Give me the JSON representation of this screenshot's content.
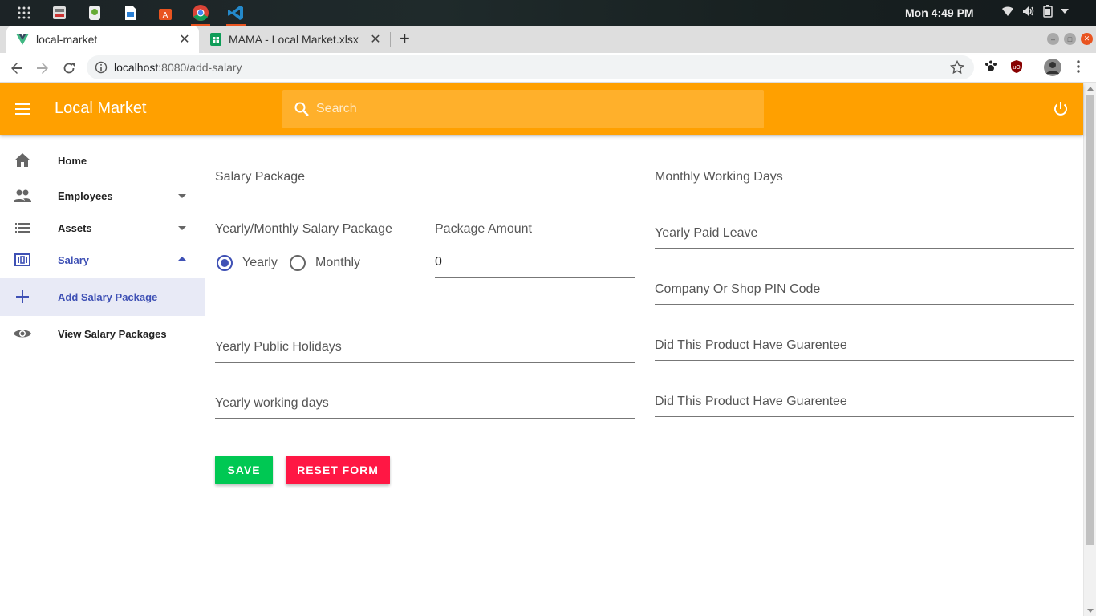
{
  "os": {
    "clock": "Mon  4:49 PM"
  },
  "browser": {
    "tabs": [
      {
        "title": "local-market"
      },
      {
        "title": "MAMA - Local Market.xlsx"
      }
    ],
    "url_host": "localhost",
    "url_path": ":8080/add-salary"
  },
  "app": {
    "title": "Local Market",
    "search_placeholder": "Search"
  },
  "sidebar": {
    "items": [
      {
        "label": "Home",
        "icon": "home-icon"
      },
      {
        "label": "Employees",
        "icon": "people-icon"
      },
      {
        "label": "Assets",
        "icon": "list-icon"
      },
      {
        "label": "Salary",
        "icon": "salary-icon"
      },
      {
        "label": "Add Salary Package",
        "icon": "plus-icon"
      },
      {
        "label": "View Salary Packages",
        "icon": "eye-icon"
      }
    ]
  },
  "form": {
    "salary_package": "Salary Package",
    "monthly_working_days": "Monthly Working Days",
    "salary_type_label": "Yearly/Monthly Salary Package",
    "radio_yearly": "Yearly",
    "radio_monthly": "Monthly",
    "package_amount_label": "Package Amount",
    "package_amount_value": "0",
    "yearly_paid_leave": "Yearly Paid Leave",
    "pin_code": "Company Or Shop PIN Code",
    "yearly_public_holidays": "Yearly Public Holidays",
    "guarantee_1": "Did This Product Have Guarentee",
    "yearly_working_days": "Yearly working days",
    "guarantee_2": "Did This Product Have Guarentee",
    "save_button": "SAVE",
    "reset_button": "RESET FORM"
  },
  "colors": {
    "toolbar": "#ffa000",
    "primary": "#3f51b5",
    "save": "#00c853",
    "reset": "#ff1744"
  }
}
